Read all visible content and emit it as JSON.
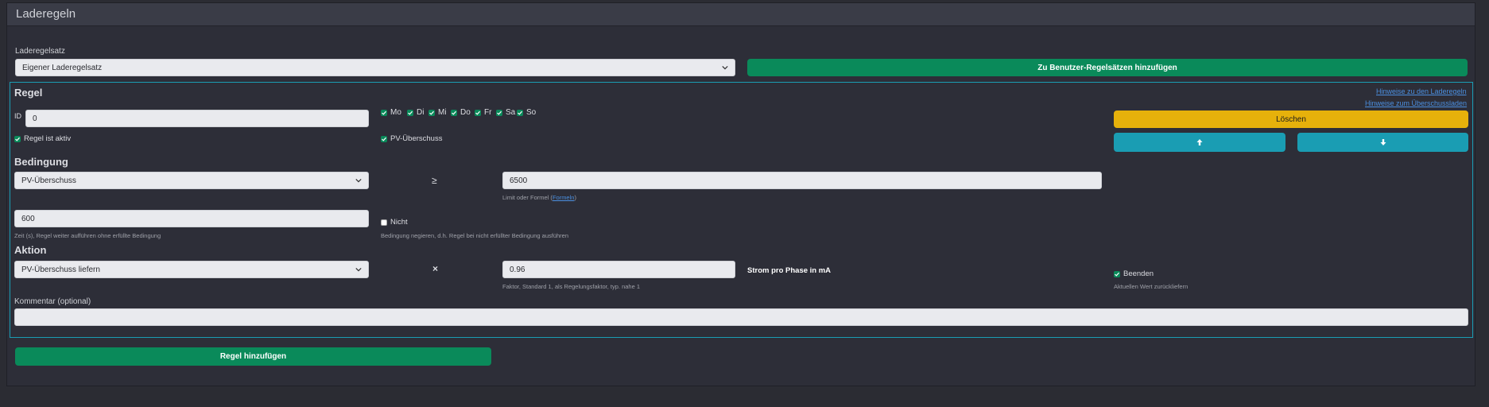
{
  "header": {
    "title": "Laderegeln"
  },
  "ruleset": {
    "label": "Laderegelsatz",
    "selected": "Eigener Laderegelsatz",
    "add_button": "Zu Benutzer-Regelsätzen hinzufügen"
  },
  "rule": {
    "title": "Regel",
    "link_hints": "Hinweise zu den Laderegeln",
    "link_surplus": "Hinweise zum Überschussladen",
    "id_label": "ID",
    "id_value": "0",
    "days": [
      {
        "label": "Mo",
        "checked": true
      },
      {
        "label": "Di",
        "checked": true
      },
      {
        "label": "Mi",
        "checked": true
      },
      {
        "label": "Do",
        "checked": true
      },
      {
        "label": "Fr",
        "checked": true
      },
      {
        "label": "Sa",
        "checked": true
      },
      {
        "label": "So",
        "checked": true
      }
    ],
    "delete_button": "Löschen",
    "active_label": "Regel ist aktiv",
    "pv_label": "PV-Überschuss"
  },
  "condition": {
    "title": "Bedingung",
    "selected": "PV-Überschuss",
    "operator": "≥",
    "limit_value": "6500",
    "limit_help_prefix": "Limit oder Formel (",
    "limit_help_link": "Formeln",
    "limit_help_suffix": ")",
    "time_value": "600",
    "time_help": "Zeit (s), Regel weiter aufführen ohne erfüllte Bedingung",
    "negate_label": "Nicht",
    "negate_help": "Bedingung negieren, d.h. Regel bei nicht erfüllter Bedingung ausführen"
  },
  "action": {
    "title": "Aktion",
    "selected": "PV-Überschuss liefern",
    "operator": "×",
    "factor_value": "0.96",
    "factor_help": "Faktor, Standard 1, als Regelungsfaktor, typ. nahe 1",
    "unit_label": "Strom pro Phase in mA",
    "end_label": "Beenden",
    "end_help": "Aktuellen Wert zurückliefern"
  },
  "comment": {
    "label": "Kommentar (optional)",
    "value": ""
  },
  "add_rule_button": "Regel hinzufügen",
  "colors": {
    "green": "#0a8a5a",
    "yellow": "#e6b10b",
    "teal": "#1a9db3",
    "link": "#4b8fe0"
  }
}
